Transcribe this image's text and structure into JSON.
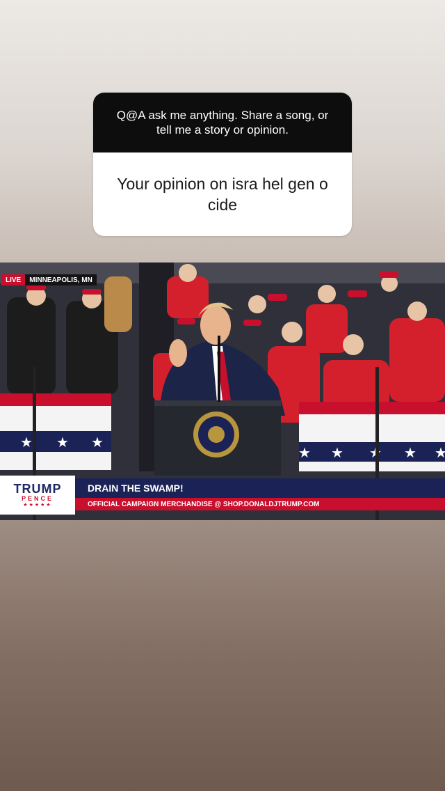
{
  "question_card": {
    "prompt": "Q@A ask me anything. Share a song, or tell me a story or opinion.",
    "response": "Your opinion on isra hel gen o cide"
  },
  "video": {
    "live_label": "LIVE",
    "location": "MINNEAPOLIS, MN",
    "podium_seal_icon": "presidential-seal-icon",
    "lower_third": {
      "logo_line1": "TRUMP",
      "logo_line2": "PENCE",
      "logo_stars": "★★★★★",
      "headline": "DRAIN THE SWAMP!",
      "subline": "OFFICIAL CAMPAIGN MERCHANDISE @ SHOP.DONALDJTRUMP.COM"
    }
  },
  "colors": {
    "accent_red": "#c8102e",
    "navy": "#1b2356"
  }
}
